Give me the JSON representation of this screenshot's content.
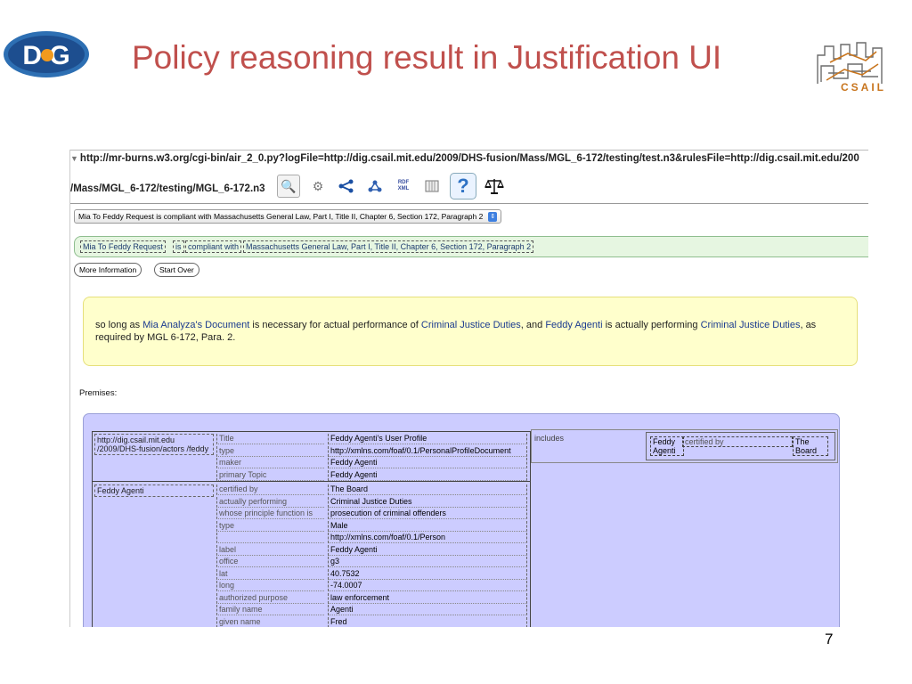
{
  "slide": {
    "title": "Policy reasoning result in Justification UI",
    "page_number": "7",
    "logos": {
      "left": "DIG",
      "right": "CSAIL"
    }
  },
  "browser": {
    "url_line1": "http://mr-burns.w3.org/cgi-bin/air_2_0.py?logFile=http://dig.csail.mit.edu/2009/DHS-fusion/Mass/MGL_6-172/testing/test.n3&rulesFile=http://dig.csail.mit.edu/200",
    "url_line2": "/Mass/MGL_6-172/testing/MGL_6-172.n3",
    "toolbar_icons": [
      "inspect-icon",
      "gear-icon",
      "share-graph-icon",
      "molecule-icon",
      "rdf-xml-icon",
      "table-icon",
      "help-icon",
      "scales-icon"
    ],
    "toolbar_labels": {
      "rdf_xml": "RDF XML",
      "help": "?"
    },
    "select_value": "Mia To Feddy Request is compliant with Massachusetts General Law, Part I, Title II, Chapter 6, Section 172, Paragraph 2",
    "result_chips": [
      "Mia To Feddy Request",
      "is",
      "compliant with",
      "Massachusetts General Law, Part I, Title II, Chapter 6, Section 172, Paragraph 2"
    ],
    "buttons": {
      "more_info": "More Information",
      "start_over": "Start Over"
    },
    "justification": {
      "t1": "so long as ",
      "l1": "Mia Analyza's Document",
      "t2": " is necessary for actual performance of ",
      "l2": "Criminal Justice Duties",
      "t3": ", and ",
      "l3": "Feddy Agenti",
      "t4": " is actually performing ",
      "l4": "Criminal Justice Duties",
      "t5": ", as required by MGL 6-172, Para. 2."
    },
    "premises_label": "Premises:",
    "table": {
      "subject1": "http://dig.csail.mit.edu /2009/DHS-fusion/actors /feddy",
      "rows1": [
        {
          "p": "Title",
          "o": "Feddy Agenti's User Profile"
        },
        {
          "p": "type",
          "o": "http://xmlns.com/foaf/0.1/PersonalProfileDocument"
        },
        {
          "p": "maker",
          "o": "Feddy Agenti"
        },
        {
          "p": "primary Topic",
          "o": "Feddy Agenti"
        }
      ],
      "subject2": "Feddy Agenti",
      "rows2": [
        {
          "p": "certified by",
          "o": "The Board"
        },
        {
          "p": "actually performing",
          "o": "Criminal Justice Duties"
        },
        {
          "p": "whose principle function is",
          "o": "prosecution of criminal offenders"
        },
        {
          "p": "type",
          "o": "Male"
        },
        {
          "p": "",
          "o": "http://xmlns.com/foaf/0.1/Person"
        },
        {
          "p": "label",
          "o": "Feddy Agenti"
        },
        {
          "p": "office",
          "o": "g3"
        },
        {
          "p": "lat",
          "o": "40.7532"
        },
        {
          "p": "long",
          "o": "-74.0007"
        },
        {
          "p": "authorized purpose",
          "o": "law enforcement"
        },
        {
          "p": "family name",
          "o": "Agenti"
        },
        {
          "p": "given name",
          "o": "Fred"
        }
      ]
    },
    "includes": {
      "label": "includes",
      "subject": "Feddy Agenti",
      "predicate": "certified by",
      "object": "The Board"
    }
  }
}
